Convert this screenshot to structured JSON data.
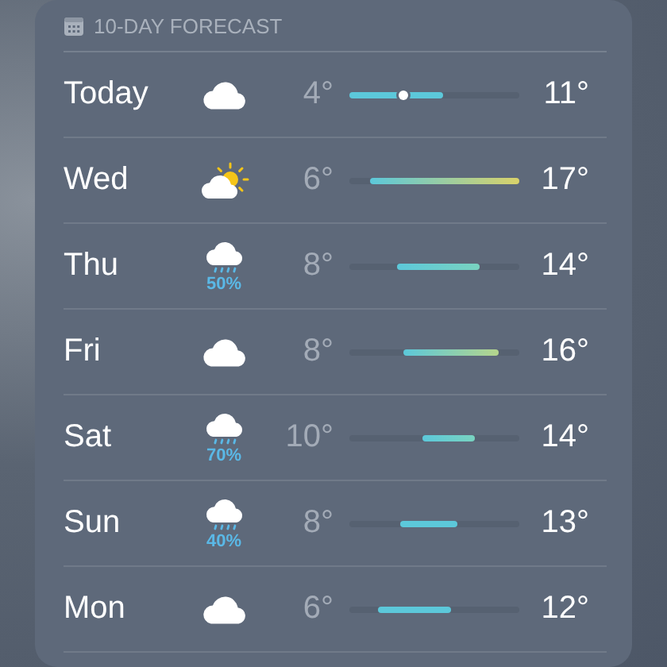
{
  "header": {
    "title": "10-DAY FORECAST"
  },
  "days": [
    {
      "day": "Today",
      "kind": "cloud",
      "low": "4°",
      "high": "11°",
      "current": {
        "level": 0.32
      }
    },
    {
      "day": "Wed",
      "kind": "partly-sunny",
      "low": "6°",
      "high": "17°"
    },
    {
      "day": "Thu",
      "kind": "rain",
      "precipitation": "50%",
      "low": "8°",
      "high": "14°"
    },
    {
      "day": "Fri",
      "kind": "cloud",
      "low": "8°",
      "high": "16°"
    },
    {
      "day": "Sat",
      "kind": "rain",
      "precipitation": "70%",
      "low": "10°",
      "high": "14°"
    },
    {
      "day": "Sun",
      "kind": "rain",
      "precipitation": "40%",
      "low": "8°",
      "high": "13°"
    },
    {
      "day": "Mon",
      "kind": "cloud",
      "low": "6°",
      "high": "12°"
    }
  ]
}
